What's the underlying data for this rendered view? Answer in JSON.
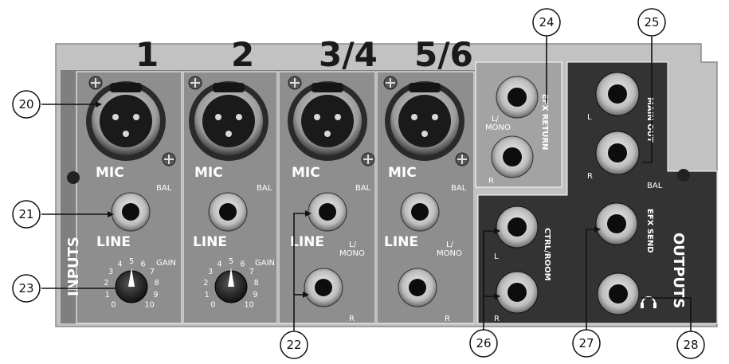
{
  "channels": [
    {
      "number": "1",
      "mic": "MIC",
      "line": "LINE",
      "bal": "BAL",
      "gain": "GAIN"
    },
    {
      "number": "2",
      "mic": "MIC",
      "line": "LINE",
      "bal": "BAL",
      "gain": "GAIN"
    },
    {
      "number": "3/4",
      "mic": "MIC",
      "line": "LINE",
      "bal": "BAL",
      "mono": "L/\nMONO",
      "r": "R"
    },
    {
      "number": "5/6",
      "mic": "MIC",
      "line": "LINE",
      "bal": "BAL",
      "mono": "L/\nMONO",
      "r": "R"
    }
  ],
  "labels": {
    "inputs": "INPUTS",
    "outputs": "OUTPUTS",
    "efx_return": "EFX RETURN",
    "efx_return_l": "L/",
    "efx_return_mono": "MONO",
    "efx_return_r": "R",
    "main_out": "MAIN OUT",
    "main_out_l": "L",
    "main_out_r": "R",
    "main_out_bal": "BAL",
    "ctrl_room": "CTRL/ROOM",
    "ctrl_l": "L",
    "ctrl_r": "R",
    "efx_send": "EFX SEND",
    "headphones_icon": "headphones-icon"
  },
  "gain_scale": [
    "0",
    "1",
    "2",
    "3",
    "4",
    "5",
    "6",
    "7",
    "8",
    "9",
    "10"
  ],
  "callouts": [
    "20",
    "21",
    "22",
    "23",
    "24",
    "25",
    "26",
    "27",
    "28"
  ],
  "colors": {
    "panel_light": "#bdbdbd",
    "panel_dark": "#333333",
    "channel": "#8a8a8a",
    "return_panel": "#9a9a9a"
  }
}
